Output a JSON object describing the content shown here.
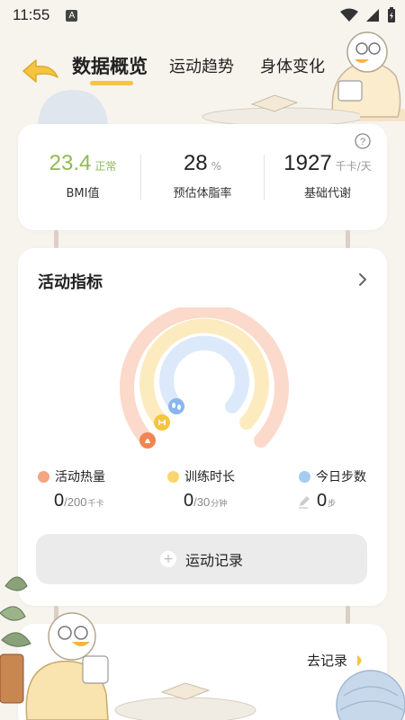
{
  "status_bar": {
    "time": "11:55",
    "a_icon_label": "A"
  },
  "nav": {
    "tabs": [
      {
        "label": "数据概览",
        "active": true
      },
      {
        "label": "运动趋势",
        "active": false
      },
      {
        "label": "身体变化",
        "active": false
      }
    ]
  },
  "metrics": [
    {
      "value": "23.4",
      "unit": "正常",
      "label": "BMI值",
      "value_color": "#8fbb4f",
      "unit_color": "#8fbb4f"
    },
    {
      "value": "28",
      "unit": "%",
      "label": "预估体脂率",
      "value_color": "#222222",
      "unit_color": "#999999"
    },
    {
      "value": "1927",
      "unit": "千卡/天",
      "label": "基础代谢",
      "value_color": "#222222",
      "unit_color": "#999999"
    }
  ],
  "activity": {
    "title": "活动指标",
    "legend": [
      {
        "name": "活动热量",
        "color": "#f4a581",
        "current": "0",
        "target": "/200",
        "unit": "千卡"
      },
      {
        "name": "训练时长",
        "color": "#f8d66d",
        "current": "0",
        "target": "/30",
        "unit": "分钟"
      },
      {
        "name": "今日步数",
        "color": "#a6cbf3",
        "current": "0",
        "target": "",
        "unit": "步"
      }
    ],
    "record_button": "运动记录"
  },
  "bottom": {
    "goto_record": "去记录"
  },
  "colors": {
    "accent": "#f5c542",
    "ring_outer": "#fbd9cb",
    "ring_middle": "#fcebbf",
    "ring_inner": "#dbe9fa"
  }
}
